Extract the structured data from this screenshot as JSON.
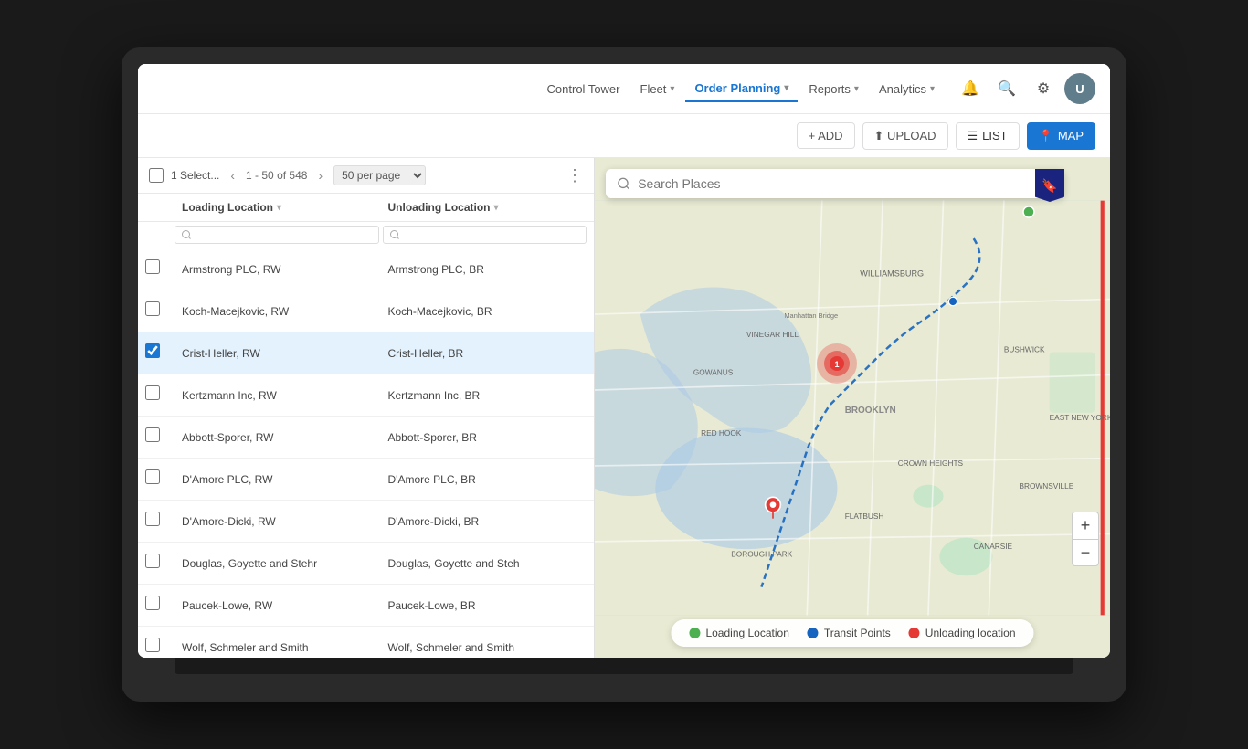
{
  "header": {
    "nav_items": [
      {
        "id": "control-tower",
        "label": "Control Tower",
        "active": false,
        "has_chevron": false
      },
      {
        "id": "fleet",
        "label": "Fleet",
        "active": false,
        "has_chevron": true
      },
      {
        "id": "order-planning",
        "label": "Order Planning",
        "active": true,
        "has_chevron": true
      },
      {
        "id": "reports",
        "label": "Reports",
        "active": false,
        "has_chevron": true
      },
      {
        "id": "analytics",
        "label": "Analytics",
        "active": false,
        "has_chevron": true
      }
    ]
  },
  "toolbar": {
    "add_label": "+ ADD",
    "upload_label": "⬆ UPLOAD",
    "list_label": "LIST",
    "map_label": "MAP"
  },
  "table": {
    "selected_count": "1 Select...",
    "pagination": "1 - 50 of 548",
    "per_page": "50 per page",
    "col_loading": "Loading Location",
    "col_unloading": "Unloading Location",
    "search_loading_placeholder": "🔍",
    "search_unloading_placeholder": "🔍",
    "rows": [
      {
        "id": 1,
        "loading": "Armstrong PLC, RW",
        "unloading": "Armstrong PLC, BR",
        "checked": false
      },
      {
        "id": 2,
        "loading": "Koch-Macejkovic, RW",
        "unloading": "Koch-Macejkovic, BR",
        "checked": false
      },
      {
        "id": 3,
        "loading": "Crist-Heller, RW",
        "unloading": "Crist-Heller, BR",
        "checked": true
      },
      {
        "id": 4,
        "loading": "Kertzmann Inc, RW",
        "unloading": "Kertzmann Inc, BR",
        "checked": false
      },
      {
        "id": 5,
        "loading": "Abbott-Sporer, RW",
        "unloading": "Abbott-Sporer, BR",
        "checked": false
      },
      {
        "id": 6,
        "loading": "D'Amore PLC, RW",
        "unloading": "D'Amore PLC, BR",
        "checked": false
      },
      {
        "id": 7,
        "loading": "D'Amore-Dicki, RW",
        "unloading": "D'Amore-Dicki, BR",
        "checked": false
      },
      {
        "id": 8,
        "loading": "Douglas, Goyette and Stehr",
        "unloading": "Douglas, Goyette and Steh",
        "checked": false
      },
      {
        "id": 9,
        "loading": "Paucek-Lowe, RW",
        "unloading": "Paucek-Lowe, BR",
        "checked": false
      },
      {
        "id": 10,
        "loading": "Wolf, Schmeler and Smith",
        "unloading": "Wolf, Schmeler and Smith",
        "checked": false
      }
    ]
  },
  "map": {
    "search_placeholder": "Search Places",
    "legend": {
      "loading_label": "Loading Location",
      "transit_label": "Transit Points",
      "unloading_label": "Unloading location"
    },
    "loading_color": "#4caf50",
    "transit_color": "#2196f3",
    "unloading_color": "#f44336"
  }
}
